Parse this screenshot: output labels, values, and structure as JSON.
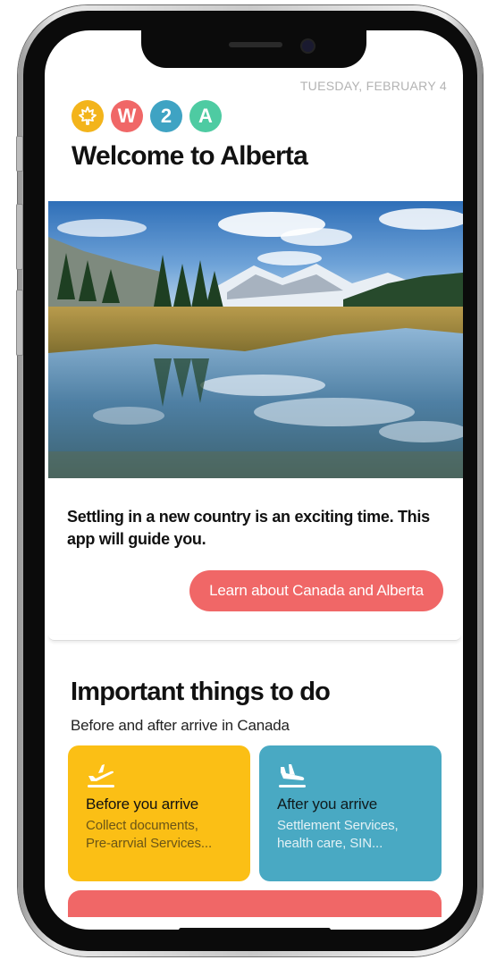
{
  "status": {
    "date": "TUESDAY, FEBRUARY 4"
  },
  "badges": [
    {
      "letter": "",
      "icon": "maple-leaf-icon",
      "color": "#f3b41b"
    },
    {
      "letter": "W",
      "color": "#f06767"
    },
    {
      "letter": "2",
      "color": "#3fa3c3"
    },
    {
      "letter": "A",
      "color": "#4ecba2"
    }
  ],
  "header": {
    "title": "Welcome to Alberta"
  },
  "hero": {
    "image": "alberta-mountain-lake-photo"
  },
  "intro_card": {
    "text": "Settling in a new country is an exciting time. This app will guide you.",
    "button_label": "Learn about Canada and Alberta",
    "button_color": "#f06767"
  },
  "things_to_do": {
    "title": "Important things to do",
    "subtitle": "Before and after arrive in Canada",
    "tiles": [
      {
        "icon": "plane-takeoff-icon",
        "title": "Before you arrive",
        "line1": "Collect documents,",
        "line2": "Pre-arrvial Services...",
        "color": "#fbbf15"
      },
      {
        "icon": "plane-landing-icon",
        "title": "After you arrive",
        "line1": "Settlement Services,",
        "line2": "health care, SIN...",
        "color": "#49a9c3"
      }
    ]
  }
}
